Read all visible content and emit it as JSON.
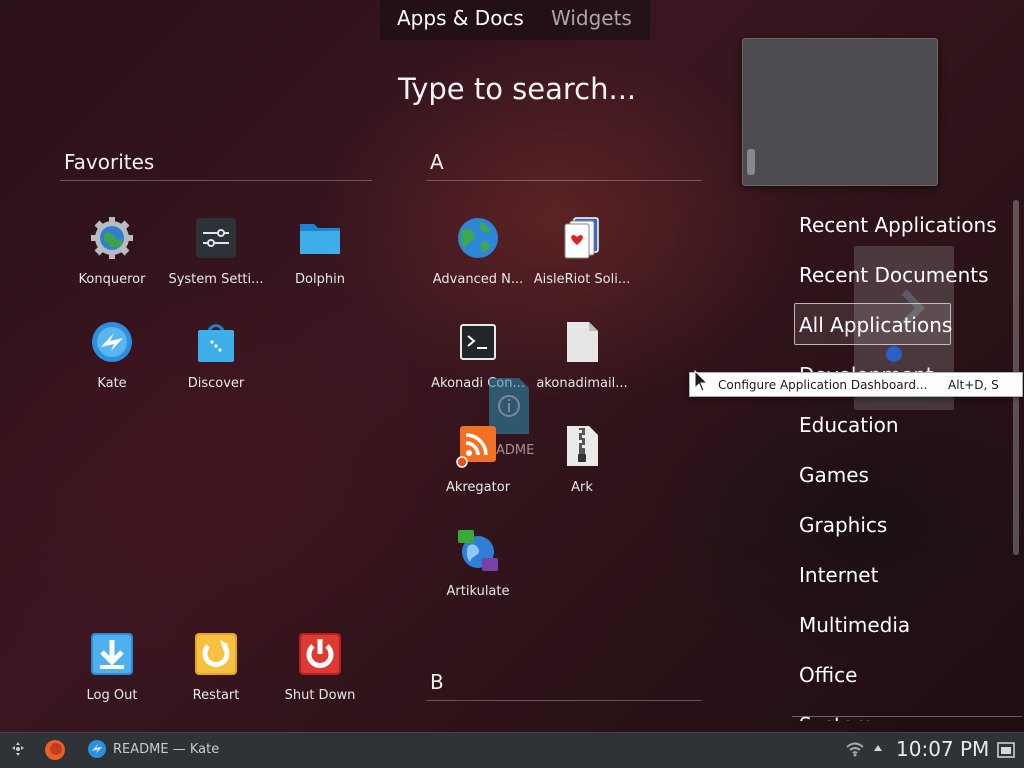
{
  "tabs": {
    "apps_docs": "Apps & Docs",
    "widgets": "Widgets"
  },
  "search": {
    "placeholder": "Type to search..."
  },
  "favorites": {
    "title": "Favorites",
    "items": [
      {
        "label": "Konqueror",
        "icon": "konqueror-icon"
      },
      {
        "label": "System Setti...",
        "icon": "system-settings-icon"
      },
      {
        "label": "Dolphin",
        "icon": "dolphin-folder-icon"
      },
      {
        "label": "Kate",
        "icon": "kate-icon"
      },
      {
        "label": "Discover",
        "icon": "discover-icon"
      }
    ]
  },
  "session": {
    "items": [
      {
        "label": "Log Out",
        "icon": "log-out-icon"
      },
      {
        "label": "Restart",
        "icon": "restart-icon"
      },
      {
        "label": "Shut Down",
        "icon": "shut-down-icon"
      }
    ]
  },
  "apps": {
    "section_a": "A",
    "section_b": "B",
    "items": [
      {
        "label": "Advanced N...",
        "icon": "globe-icon"
      },
      {
        "label": "AisleRiot Soli...",
        "icon": "cards-icon"
      },
      {
        "label": "Akonadi Con...",
        "icon": "terminal-icon"
      },
      {
        "label": "akonadimail...",
        "icon": "file-icon"
      },
      {
        "label": "Akregator",
        "icon": "rss-icon"
      },
      {
        "label": "Ark",
        "icon": "archive-icon"
      },
      {
        "label": "Artikulate",
        "icon": "artikulate-icon"
      }
    ],
    "drag_label": "ADME"
  },
  "categories": {
    "items": [
      "Recent Applications",
      "Recent Documents",
      "All Applications",
      "Development",
      "Education",
      "Games",
      "Graphics",
      "Internet",
      "Multimedia",
      "Office",
      "System"
    ],
    "selected": "All Applications"
  },
  "context_menu": {
    "label": "Configure Application Dashboard...",
    "shortcut": "Alt+D, S"
  },
  "taskbar": {
    "window_title": "README — Kate",
    "clock": "10:07 PM"
  },
  "colors": {
    "accent": "#3daee9",
    "taskbar": "#2f3237",
    "background": "#2a1018"
  }
}
